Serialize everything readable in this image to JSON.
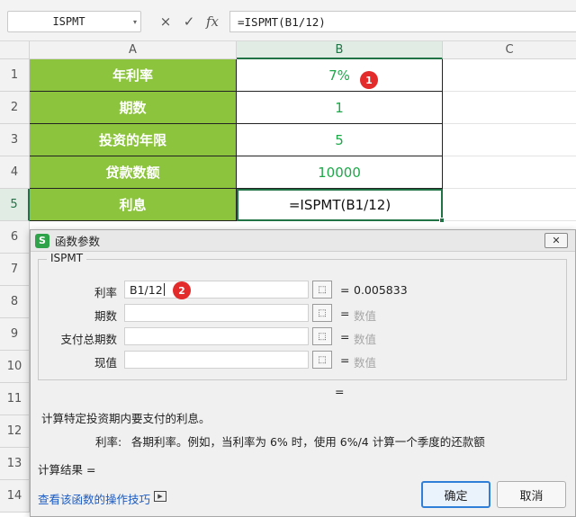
{
  "formula_bar": {
    "name_box": "ISPMT",
    "cancel_icon": "×",
    "confirm_icon": "✓",
    "fx_label": "fx",
    "formula": "=ISPMT(B1/12)"
  },
  "columns": [
    "A",
    "B",
    "C"
  ],
  "rows": [
    "1",
    "2",
    "3",
    "4",
    "5",
    "6",
    "7",
    "8",
    "9",
    "10",
    "11",
    "12",
    "13",
    "14"
  ],
  "cells": [
    {
      "a": "年利率",
      "b": "7%"
    },
    {
      "a": "期数",
      "b": "1"
    },
    {
      "a": "投资的年限",
      "b": "5"
    },
    {
      "a": "贷款数额",
      "b": "10000"
    },
    {
      "a": "利息",
      "b": "=ISPMT(B1/12)"
    }
  ],
  "badges": {
    "first": "1",
    "second": "2"
  },
  "dialog": {
    "logo": "S",
    "title": "函数参数",
    "close_icon": "✕",
    "group_label": "ISPMT",
    "args": [
      {
        "label": "利率",
        "value": "B1/12",
        "result": "0.005833"
      },
      {
        "label": "期数",
        "value": "",
        "result": "数值"
      },
      {
        "label": "支付总期数",
        "value": "",
        "result": "数值"
      },
      {
        "label": "现值",
        "value": "",
        "result": "数值"
      }
    ],
    "eq": "=",
    "function_result_eq": "=",
    "description": "计算特定投资期内要支付的利息。",
    "param_name": "利率:",
    "param_desc": "各期利率。例如，当利率为 6% 时，使用 6%/4 计算一个季度的还款额",
    "calc_result_label": "计算结果  =",
    "help_link": "查看该函数的操作技巧",
    "ok_label": "确定",
    "cancel_label": "取消"
  }
}
